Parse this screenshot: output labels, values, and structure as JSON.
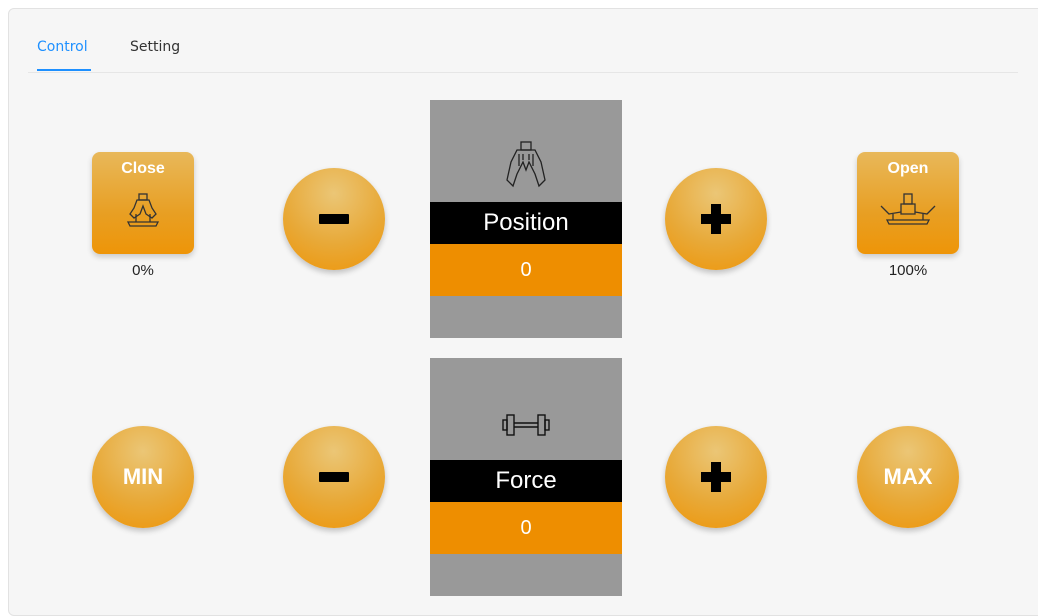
{
  "tabs": [
    {
      "label": "Control",
      "active": true
    },
    {
      "label": "Setting",
      "active": false
    }
  ],
  "position_row": {
    "close_button": {
      "label": "Close",
      "icon": "gripper-closed-icon",
      "percent": "0%"
    },
    "open_button": {
      "label": "Open",
      "icon": "gripper-open-icon",
      "percent": "100%"
    },
    "decrement_icon": "minus-icon",
    "increment_icon": "plus-icon",
    "panel": {
      "icon": "gripper-icon",
      "label": "Position",
      "value": "0"
    }
  },
  "force_row": {
    "min_button": {
      "label": "MIN"
    },
    "max_button": {
      "label": "MAX"
    },
    "decrement_icon": "minus-icon",
    "increment_icon": "plus-icon",
    "panel": {
      "icon": "dumbbell-icon",
      "label": "Force",
      "value": "0"
    }
  },
  "colors": {
    "accent_tab": "#1e90ff",
    "button_orange": "#ee9508",
    "panel_gray": "#999999",
    "panel_value_orange": "#ee8e00",
    "panel_label_bg": "#000000"
  }
}
